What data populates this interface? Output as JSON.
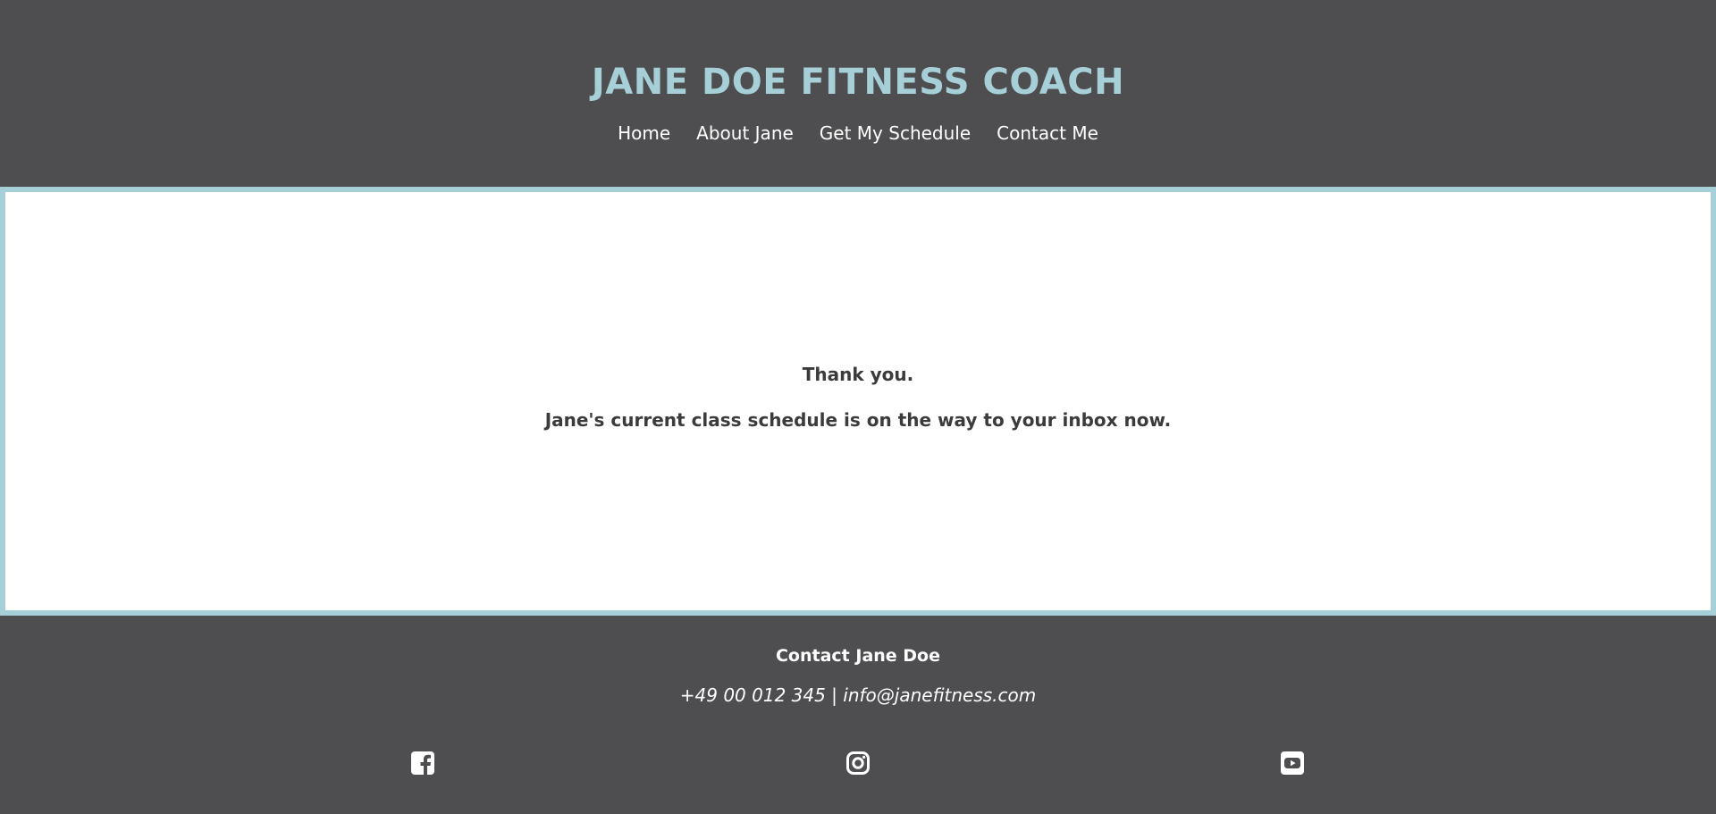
{
  "header": {
    "title": "JANE DOE FITNESS COACH",
    "nav": [
      {
        "label": "Home"
      },
      {
        "label": "About Jane"
      },
      {
        "label": "Get My Schedule"
      },
      {
        "label": "Contact Me"
      }
    ]
  },
  "main": {
    "line1": "Thank you.",
    "line2": "Jane's current class schedule is on the way to your inbox now."
  },
  "footer": {
    "heading": "Contact Jane Doe",
    "contact": "+49 00 012 345 | info@janefitness.com",
    "social": [
      {
        "icon": "facebook-icon"
      },
      {
        "icon": "instagram-icon"
      },
      {
        "icon": "youtube-icon"
      }
    ]
  },
  "colors": {
    "background": "#4e4d4f",
    "accent": "#a6cfd8",
    "text_dark": "#3b3b3b",
    "text_light": "#ffffff"
  }
}
